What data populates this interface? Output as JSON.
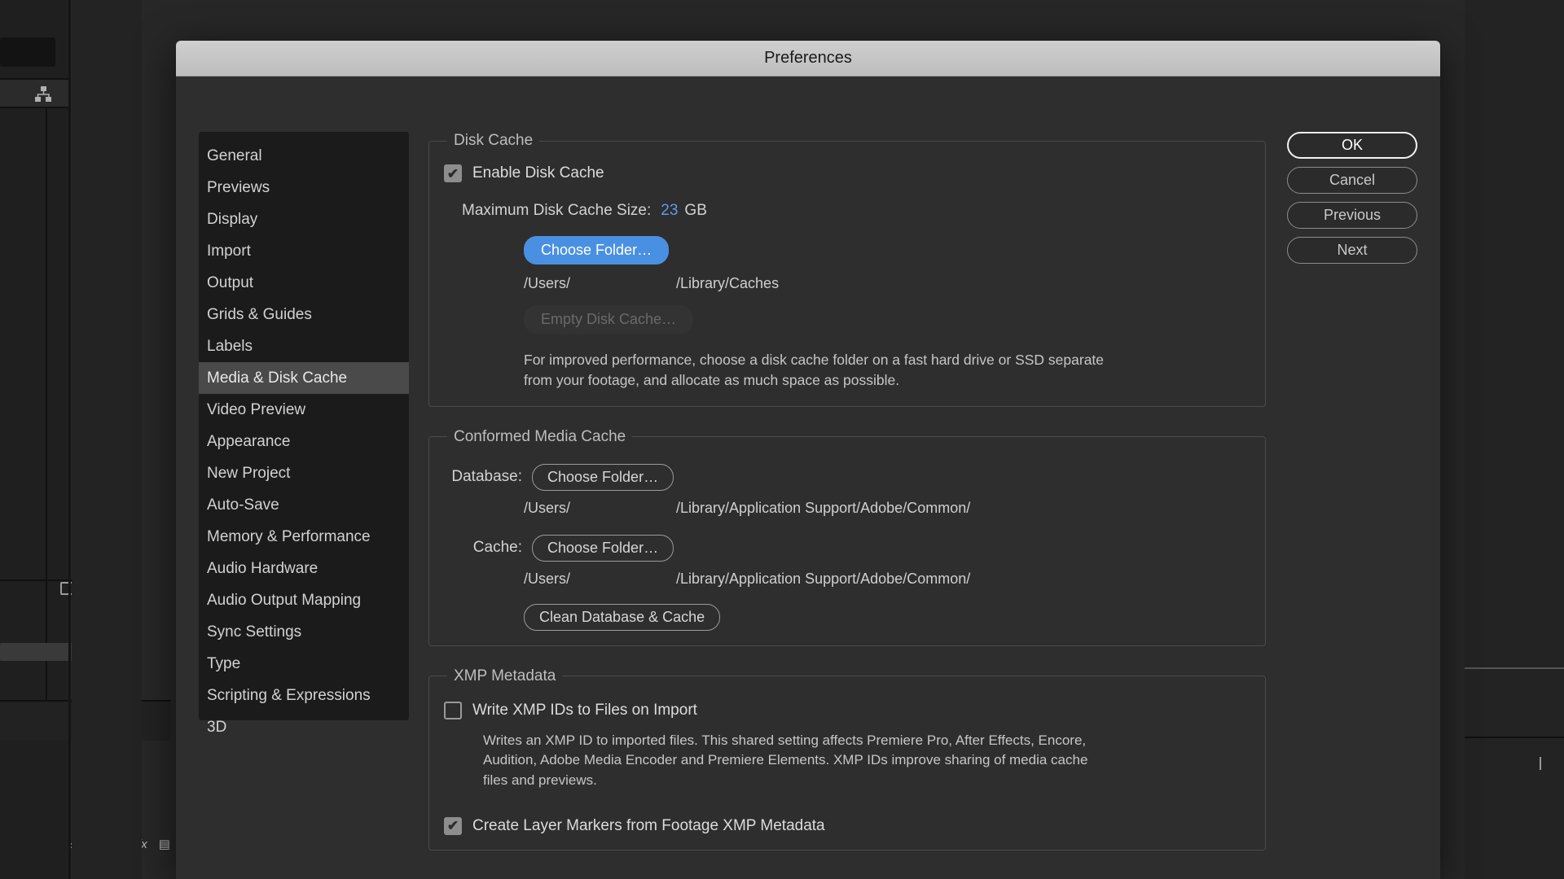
{
  "window": {
    "title": "Preferences"
  },
  "sidebar": {
    "items": [
      {
        "label": "General",
        "active": false
      },
      {
        "label": "Previews",
        "active": false
      },
      {
        "label": "Display",
        "active": false
      },
      {
        "label": "Import",
        "active": false
      },
      {
        "label": "Output",
        "active": false
      },
      {
        "label": "Grids & Guides",
        "active": false
      },
      {
        "label": "Labels",
        "active": false
      },
      {
        "label": "Media & Disk Cache",
        "active": true
      },
      {
        "label": "Video Preview",
        "active": false
      },
      {
        "label": "Appearance",
        "active": false
      },
      {
        "label": "New Project",
        "active": false
      },
      {
        "label": "Auto-Save",
        "active": false
      },
      {
        "label": "Memory & Performance",
        "active": false
      },
      {
        "label": "Audio Hardware",
        "active": false
      },
      {
        "label": "Audio Output Mapping",
        "active": false
      },
      {
        "label": "Sync Settings",
        "active": false
      },
      {
        "label": "Type",
        "active": false
      },
      {
        "label": "Scripting & Expressions",
        "active": false
      },
      {
        "label": "3D",
        "active": false
      }
    ]
  },
  "actions": {
    "ok": "OK",
    "cancel": "Cancel",
    "previous": "Previous",
    "next": "Next"
  },
  "disk_cache": {
    "legend": "Disk Cache",
    "enable_label": "Enable Disk Cache",
    "enable_checked": true,
    "max_size_label": "Maximum Disk Cache Size:",
    "max_size_value": "23",
    "max_size_unit": "GB",
    "choose_folder_label": "Choose Folder…",
    "path_user": "/Users/",
    "path_rest": "/Library/Caches",
    "empty_label": "Empty Disk Cache…",
    "description": "For improved performance, choose a disk cache folder on a fast hard drive or SSD separate from your footage, and allocate as much space as possible."
  },
  "conformed_media_cache": {
    "legend": "Conformed Media Cache",
    "database_label": "Database:",
    "database_button": "Choose Folder…",
    "database_path_user": "/Users/",
    "database_path_rest": "/Library/Application Support/Adobe/Common/",
    "cache_label": "Cache:",
    "cache_button": "Choose Folder…",
    "cache_path_user": "/Users/",
    "cache_path_rest": "/Library/Application Support/Adobe/Common/",
    "clean_button": "Clean Database & Cache"
  },
  "xmp_metadata": {
    "legend": "XMP Metadata",
    "write_label": "Write XMP IDs to Files on Import",
    "write_checked": false,
    "write_description": "Writes an XMP ID to imported files. This shared setting affects Premiere Pro, After Effects, Encore, Audition, Adobe Media Encoder and Premiere Elements. XMP IDs improve sharing of media cache files and previews.",
    "layer_markers_label": "Create Layer Markers from Footage XMP Metadata",
    "layer_markers_checked": true
  },
  "colors": {
    "accent_blue": "#4a90e2",
    "value_blue": "#5c9ced",
    "modal_bg": "#2e2e2e",
    "sidebar_bg": "#1b1b1b",
    "active_item_bg": "#4a4a4a"
  },
  "tick_glyph": "✔"
}
